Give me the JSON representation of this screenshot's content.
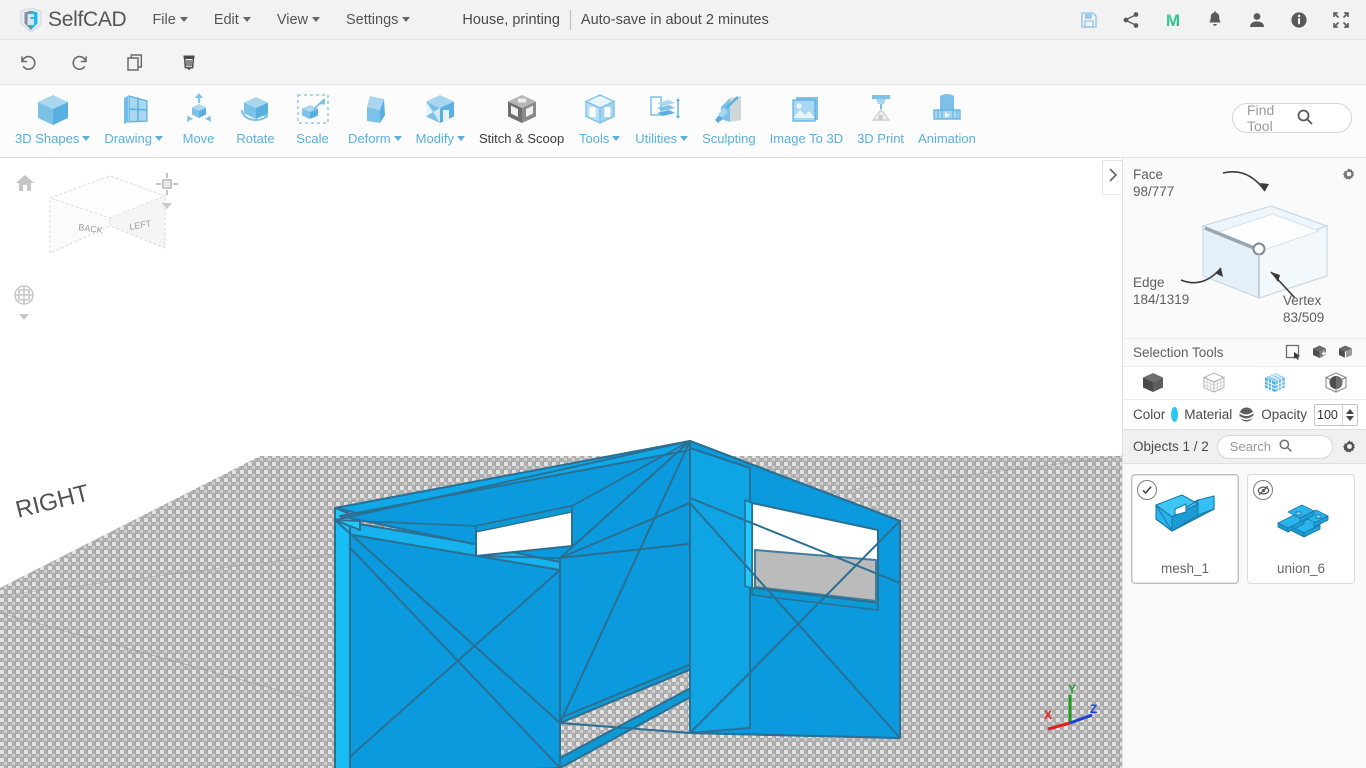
{
  "app": {
    "name": "SelfCAD",
    "logo_icon": "selfcad-logo-icon"
  },
  "menubar": {
    "items": [
      {
        "label": "File",
        "has_caret": true
      },
      {
        "label": "Edit",
        "has_caret": true
      },
      {
        "label": "View",
        "has_caret": true
      },
      {
        "label": "Settings",
        "has_caret": true
      }
    ],
    "document_title": "House, printing",
    "autosave_text": "Auto-save in about 2 minutes",
    "right_icons": [
      {
        "name": "save-icon",
        "title": "Save"
      },
      {
        "name": "share-icon",
        "title": "Share"
      },
      {
        "name": "m-brand-icon",
        "title": "M"
      },
      {
        "name": "notifications-bell-icon",
        "title": "Notifications"
      },
      {
        "name": "user-account-icon",
        "title": "Account"
      },
      {
        "name": "info-icon",
        "title": "Info"
      },
      {
        "name": "fullscreen-icon",
        "title": "Fullscreen"
      }
    ]
  },
  "actionbar": {
    "buttons": [
      {
        "name": "undo-icon",
        "label": "Undo"
      },
      {
        "name": "redo-icon",
        "label": "Redo"
      },
      {
        "name": "copy-icon",
        "label": "Copy"
      },
      {
        "name": "delete-icon",
        "label": "Delete"
      }
    ]
  },
  "toolbar": {
    "tools": [
      {
        "label": "3D Shapes",
        "icon": "cube-icon",
        "caret": true,
        "active": false
      },
      {
        "label": "Drawing",
        "icon": "drawing-icon",
        "caret": true,
        "active": false
      },
      {
        "label": "Move",
        "icon": "move-icon",
        "caret": false,
        "active": false
      },
      {
        "label": "Rotate",
        "icon": "rotate-icon",
        "caret": false,
        "active": false
      },
      {
        "label": "Scale",
        "icon": "scale-icon",
        "caret": false,
        "active": false
      },
      {
        "label": "Deform",
        "icon": "deform-icon",
        "caret": true,
        "active": false
      },
      {
        "label": "Modify",
        "icon": "modify-icon",
        "caret": true,
        "active": false
      },
      {
        "label": "Stitch & Scoop",
        "icon": "stitch-scoop-icon",
        "caret": false,
        "active": true
      },
      {
        "label": "Tools",
        "icon": "tools-icon",
        "caret": true,
        "active": false
      },
      {
        "label": "Utilities",
        "icon": "utilities-icon",
        "caret": true,
        "active": false
      },
      {
        "label": "Sculpting",
        "icon": "sculpting-icon",
        "caret": false,
        "active": false
      },
      {
        "label": "Image To 3D",
        "icon": "image-to-3d-icon",
        "caret": false,
        "active": false
      },
      {
        "label": "3D Print",
        "icon": "3d-print-icon",
        "caret": false,
        "active": false
      },
      {
        "label": "Animation",
        "icon": "animation-icon",
        "caret": false,
        "active": false
      }
    ],
    "find_tool_placeholder": "Find Tool"
  },
  "viewport": {
    "navcube": {
      "face_back": "BACK",
      "face_left": "LEFT",
      "home_icon": "home-icon",
      "view_preset_icon": "view-preset-icon",
      "projection_icon": "perspective-projection-icon"
    },
    "ground_label": "RIGHT",
    "axis_gizmo": {
      "x_label": "X",
      "y_label": "Y",
      "z_label": "Z",
      "x_color": "#e02020",
      "y_color": "#23a024",
      "z_color": "#1c41d8"
    },
    "model_color": "#0b9ade",
    "model_highlight_color": "#18bdf4",
    "collapse_icon": "chevron-right-icon"
  },
  "panel": {
    "selection_counts": {
      "face_label": "Face",
      "face_value": "98/777",
      "edge_label": "Edge",
      "edge_value": "184/1319",
      "vertex_label": "Vertex",
      "vertex_value": "83/509",
      "settings_icon": "gear-icon"
    },
    "selection_tools": {
      "label": "Selection Tools",
      "icons": [
        {
          "name": "rectangle-select-icon"
        },
        {
          "name": "select-through-icon"
        },
        {
          "name": "select-all-icon"
        }
      ]
    },
    "selection_modes": [
      {
        "name": "object-mode-icon",
        "active": false
      },
      {
        "name": "vertex-mode-icon",
        "active": false
      },
      {
        "name": "face-mode-icon",
        "active": true
      },
      {
        "name": "sphere-select-icon",
        "active": false
      }
    ],
    "appearance": {
      "color_label": "Color",
      "color_value": "#29c7f0",
      "material_label": "Material",
      "material_icon": "material-sphere-icon",
      "opacity_label": "Opacity",
      "opacity_value": "100"
    },
    "objects": {
      "header": "Objects 1 / 2",
      "search_placeholder": "Search",
      "settings_icon": "gear-icon",
      "items": [
        {
          "name": "mesh_1",
          "state": "visible-selected",
          "badge_icon": "check-icon"
        },
        {
          "name": "union_6",
          "state": "hidden",
          "badge_icon": "eye-slash-icon"
        }
      ]
    }
  }
}
